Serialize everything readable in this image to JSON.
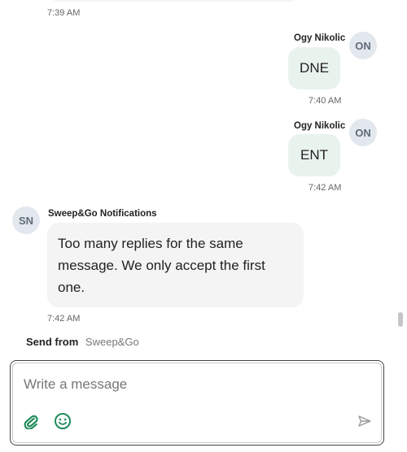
{
  "thread": {
    "top_timestamp": "7:39 AM",
    "messages": [
      {
        "sender": "Ogy Nikolic",
        "avatar": "ON",
        "text": "DNE",
        "time": "7:40 AM"
      },
      {
        "sender": "Ogy Nikolic",
        "avatar": "ON",
        "text": "ENT",
        "time": "7:42 AM"
      },
      {
        "sender": "Sweep&Go Notifications",
        "avatar": "SN",
        "text": "Too many replies for the same message. We only accept the first one.",
        "time": "7:42 AM"
      }
    ]
  },
  "send_from": {
    "label": "Send from",
    "value": "Sweep&Go"
  },
  "composer": {
    "placeholder": "Write a message",
    "value": "",
    "attach_icon": "paperclip-icon",
    "emoji_icon": "smiley-icon",
    "send_icon": "send-icon"
  },
  "colors": {
    "outgoing_bubble": "#e9f3ee",
    "incoming_bubble": "#f4f4f5",
    "avatar_bg": "#e3e8ee",
    "accent_green": "#1f8a5b"
  }
}
